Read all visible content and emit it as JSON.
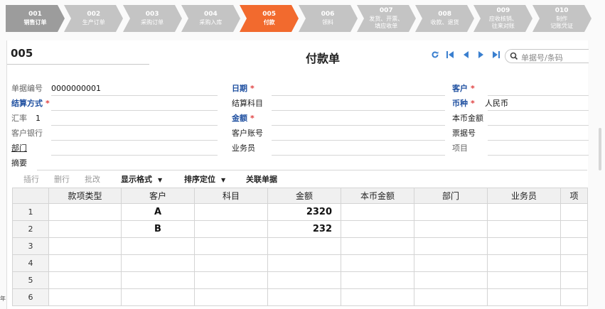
{
  "steps": [
    {
      "num": "001",
      "label": "销售订单",
      "state": "first"
    },
    {
      "num": "002",
      "label": "生产订单",
      "state": "normal"
    },
    {
      "num": "003",
      "label": "采购订单",
      "state": "normal"
    },
    {
      "num": "004",
      "label": "采购入库",
      "state": "normal"
    },
    {
      "num": "005",
      "label": "付款",
      "state": "active"
    },
    {
      "num": "006",
      "label": "领料",
      "state": "normal"
    },
    {
      "num": "007",
      "label": "发货、开票、\n填应收单",
      "state": "normal"
    },
    {
      "num": "008",
      "label": "收款、退货",
      "state": "normal"
    },
    {
      "num": "009",
      "label": "应收核销、\n往来对账",
      "state": "normal"
    },
    {
      "num": "010",
      "label": "制作\n记账凭证",
      "state": "normal"
    }
  ],
  "colors": {
    "active": "#f26a2e",
    "step_gray": "#c4c4c4",
    "step_first": "#9c9c9c",
    "required_label": "#1e4fa0",
    "link_blue": "#3a7fcf"
  },
  "window": {
    "code": "005",
    "form_title": "付款单",
    "nav_icons": [
      "refresh-icon",
      "first-record-icon",
      "prev-record-icon",
      "next-record-icon",
      "last-record-icon"
    ],
    "search_placeholder": "单据号/条码"
  },
  "fields": {
    "doc_no": {
      "label": "单据编号",
      "value": "0000000001"
    },
    "date": {
      "label": "日期",
      "value": ""
    },
    "customer": {
      "label": "客户",
      "value": ""
    },
    "settle_method": {
      "label": "结算方式",
      "value": ""
    },
    "settle_subject": {
      "label": "结算科目",
      "value": ""
    },
    "currency": {
      "label": "币种",
      "value": "人民币"
    },
    "rate": {
      "label": "汇率",
      "value": "1"
    },
    "amount": {
      "label": "金额",
      "value": ""
    },
    "local_amount": {
      "label": "本币金额",
      "value": ""
    },
    "cust_bank": {
      "label": "客户银行",
      "value": ""
    },
    "cust_account": {
      "label": "客户账号",
      "value": ""
    },
    "bill_no": {
      "label": "票据号",
      "value": ""
    },
    "dept": {
      "label": "部门",
      "value": ""
    },
    "clerk": {
      "label": "业务员",
      "value": ""
    },
    "project": {
      "label": "项目",
      "value": ""
    },
    "memo": {
      "label": "摘要",
      "value": ""
    }
  },
  "toolbar": {
    "insert": "插行",
    "delete": "删行",
    "batch": "批改",
    "display_format": "显示格式",
    "sort_locate": "排序定位",
    "related_docs": "关联单据"
  },
  "table": {
    "columns": [
      "款项类型",
      "客户",
      "科目",
      "金额",
      "本币金额",
      "部门",
      "业务员",
      "项"
    ],
    "rows": [
      {
        "n": "1",
        "type": "",
        "customer": "A",
        "subject": "",
        "amount": "2320",
        "local": "",
        "dept": "",
        "clerk": "",
        "item": ""
      },
      {
        "n": "2",
        "type": "",
        "customer": "B",
        "subject": "",
        "amount": "232",
        "local": "",
        "dept": "",
        "clerk": "",
        "item": ""
      },
      {
        "n": "3",
        "type": "",
        "customer": "",
        "subject": "",
        "amount": "",
        "local": "",
        "dept": "",
        "clerk": "",
        "item": ""
      },
      {
        "n": "4",
        "type": "",
        "customer": "",
        "subject": "",
        "amount": "",
        "local": "",
        "dept": "",
        "clerk": "",
        "item": ""
      },
      {
        "n": "5",
        "type": "",
        "customer": "",
        "subject": "",
        "amount": "",
        "local": "",
        "dept": "",
        "clerk": "",
        "item": ""
      },
      {
        "n": "6",
        "type": "",
        "customer": "",
        "subject": "",
        "amount": "",
        "local": "",
        "dept": "",
        "clerk": "",
        "item": ""
      }
    ]
  },
  "fragment_left": "年"
}
